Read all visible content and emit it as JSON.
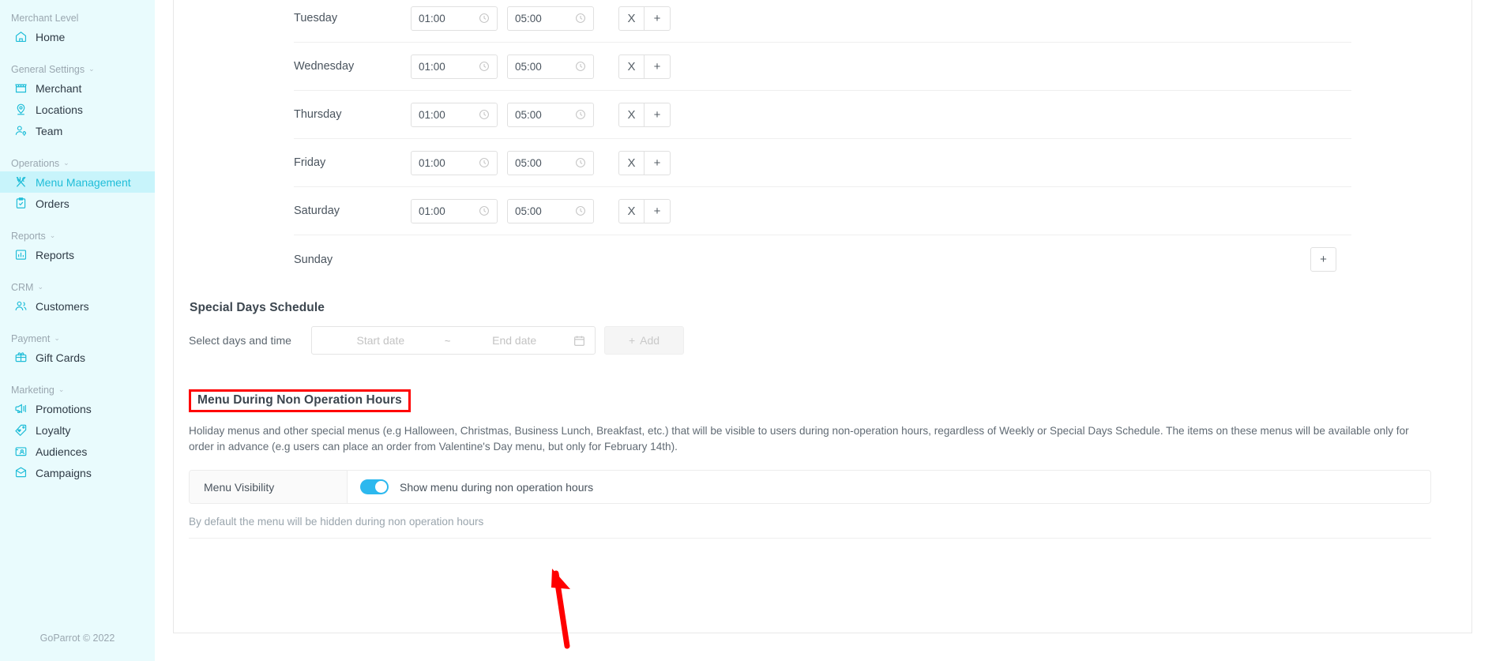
{
  "sidebar": {
    "groups": [
      {
        "label": "Merchant Level",
        "caret": false,
        "items": [
          {
            "label": "Home",
            "icon": "home-icon",
            "active": false
          }
        ]
      },
      {
        "label": "General Settings",
        "caret": true,
        "items": [
          {
            "label": "Merchant",
            "icon": "store-icon",
            "active": false
          },
          {
            "label": "Locations",
            "icon": "location-pin-icon",
            "active": false
          },
          {
            "label": "Team",
            "icon": "team-icon",
            "active": false
          }
        ]
      },
      {
        "label": "Operations",
        "caret": true,
        "items": [
          {
            "label": "Menu Management",
            "icon": "cutlery-icon",
            "active": true
          },
          {
            "label": "Orders",
            "icon": "clipboard-check-icon",
            "active": false
          }
        ]
      },
      {
        "label": "Reports",
        "caret": true,
        "items": [
          {
            "label": "Reports",
            "icon": "bar-chart-icon",
            "active": false
          }
        ]
      },
      {
        "label": "CRM",
        "caret": true,
        "items": [
          {
            "label": "Customers",
            "icon": "customers-icon",
            "active": false
          }
        ]
      },
      {
        "label": "Payment",
        "caret": true,
        "items": [
          {
            "label": "Gift Cards",
            "icon": "gift-card-icon",
            "active": false
          }
        ]
      },
      {
        "label": "Marketing",
        "caret": true,
        "items": [
          {
            "label": "Promotions",
            "icon": "megaphone-icon",
            "active": false
          },
          {
            "label": "Loyalty",
            "icon": "tag-heart-icon",
            "active": false
          },
          {
            "label": "Audiences",
            "icon": "audiences-icon",
            "active": false
          },
          {
            "label": "Campaigns",
            "icon": "envelope-icon",
            "active": false
          }
        ]
      }
    ],
    "footer": "GoParrot © 2022"
  },
  "weekly_schedule": {
    "rows": [
      {
        "day": "Tuesday",
        "start": "01:00",
        "end": "05:00",
        "has_times": true,
        "remove": "X",
        "add": "+"
      },
      {
        "day": "Wednesday",
        "start": "01:00",
        "end": "05:00",
        "has_times": true,
        "remove": "X",
        "add": "+"
      },
      {
        "day": "Thursday",
        "start": "01:00",
        "end": "05:00",
        "has_times": true,
        "remove": "X",
        "add": "+"
      },
      {
        "day": "Friday",
        "start": "01:00",
        "end": "05:00",
        "has_times": true,
        "remove": "X",
        "add": "+"
      },
      {
        "day": "Saturday",
        "start": "01:00",
        "end": "05:00",
        "has_times": true,
        "remove": "X",
        "add": "+"
      },
      {
        "day": "Sunday",
        "start": "",
        "end": "",
        "has_times": false,
        "remove": "",
        "add": "+"
      }
    ]
  },
  "special_days": {
    "title": "Special Days Schedule",
    "select_label": "Select days and time",
    "start_placeholder": "Start date",
    "separator": "~",
    "end_placeholder": "End date",
    "calendar_icon": "calendar-icon",
    "add_label": "Add",
    "add_plus": "+"
  },
  "non_operation": {
    "title": "Menu During Non Operation Hours",
    "highlight_color": "#ff0000",
    "description": "Holiday menus and other special menus (e.g Halloween, Christmas, Business Lunch, Breakfast, etc.) that will be visible to users during non-operation hours, regardless of Weekly or Special Days Schedule. The items on these menus will be available only for order in advance (e.g users can place an order from Valentine's Day menu, but only for February 14th).",
    "visibility_label": "Menu Visibility",
    "toggle_state": "on",
    "toggle_color": "#2cb8ee",
    "toggle_text": "Show menu during non operation hours",
    "hint": "By default the menu will be hidden during non operation hours"
  },
  "annotation": {
    "arrow_color": "#ff0000",
    "points_at": "menu-visibility-toggle"
  }
}
